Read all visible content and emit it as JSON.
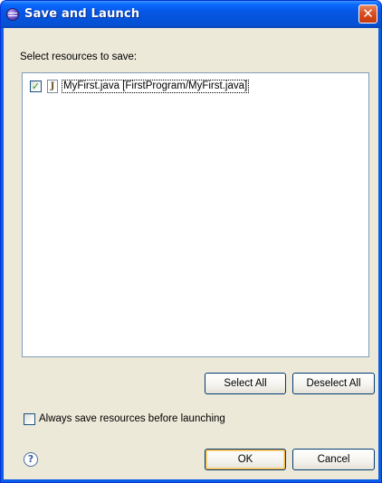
{
  "window": {
    "title": "Save and Launch",
    "close_symbol": "✕"
  },
  "dialog": {
    "prompt": "Select resources to save:",
    "resources": [
      {
        "checked": true,
        "icon": "java-file-icon",
        "icon_glyph": "J",
        "label": "MyFirst.java  [FirstProgram/MyFirst.java]"
      }
    ],
    "check_glyph": "✓",
    "select_all_label": "Select All",
    "deselect_all_label": "Deselect All",
    "always_save_label": "Always save resources before launching",
    "always_save_checked": false,
    "help_glyph": "?",
    "ok_label": "OK",
    "cancel_label": "Cancel"
  },
  "colors": {
    "titlebar_blue": "#0553d9",
    "close_red": "#d94f20",
    "dialog_bg": "#ece9d8",
    "list_border": "#7f9db9",
    "check_green": "#21a121"
  }
}
